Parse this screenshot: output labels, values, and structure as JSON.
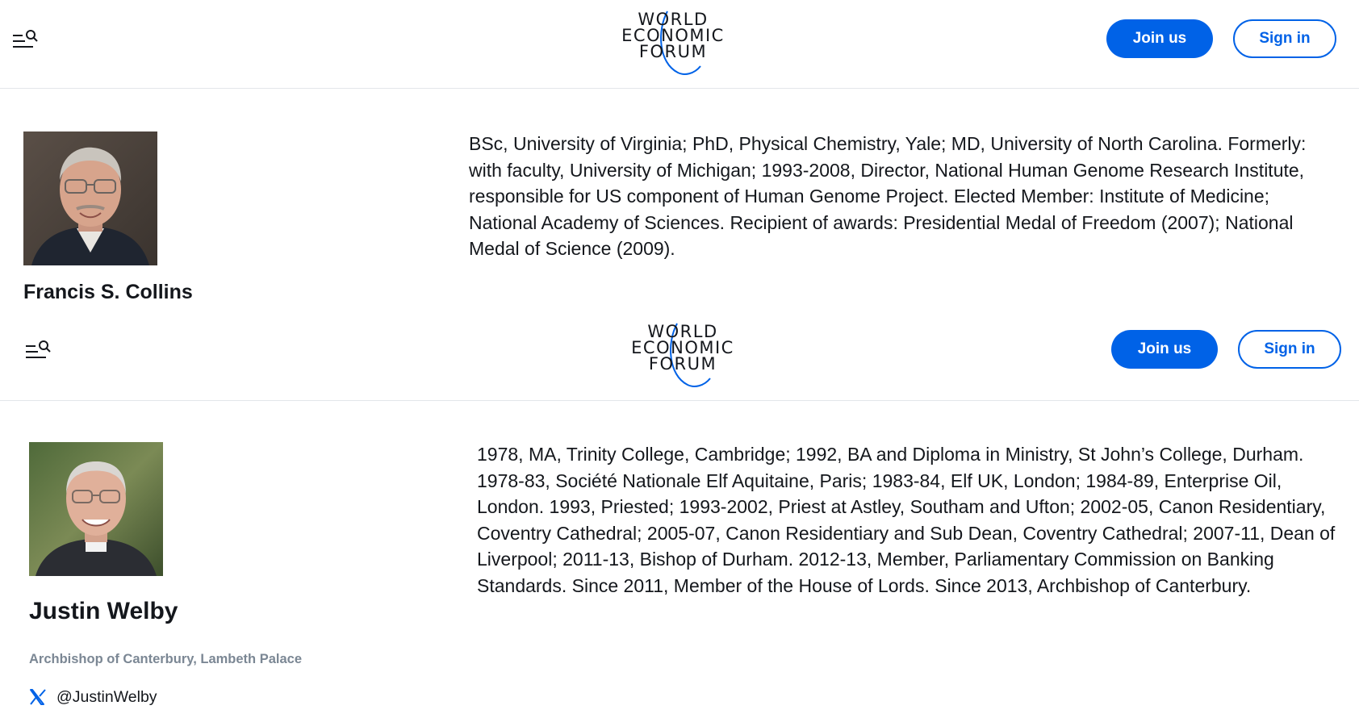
{
  "brand": {
    "logo_lines": [
      "WORLD",
      "ECONOMIC",
      "FORUM"
    ],
    "accent": "#0062e7"
  },
  "header": {
    "join_label": "Join us",
    "signin_label": "Sign in",
    "menu_icon": "menu-search-icon"
  },
  "profiles": [
    {
      "name": "Francis S. Collins",
      "bio": "BSc, University of Virginia; PhD, Physical Chemistry, Yale; MD, University of North Carolina. Formerly: with faculty, University of Michigan; 1993-2008, Director, National Human Genome Research Institute, responsible for US component of Human Genome Project. Elected Member: Institute of Medicine; National Academy of Sciences. Recipient of awards: Presidential Medal of Freedom (2007); National Medal of Science (2009)."
    },
    {
      "name": "Justin Welby",
      "title": "Archbishop of Canterbury, Lambeth Palace",
      "social_icon": "x-logo-icon",
      "handle": "@JustinWelby",
      "bio": "1978, MA, Trinity College, Cambridge; 1992, BA and Diploma in Ministry, St John’s College, Durham. 1978-83, Société Nationale Elf Aquitaine, Paris; 1983-84, Elf UK, London; 1984-89, Enterprise Oil, London. 1993, Priested; 1993-2002, Priest at Astley, Southam and Ufton; 2002-05, Canon Residentiary, Coventry Cathedral; 2005-07, Canon Residentiary and Sub Dean, Coventry Cathedral; 2007-11, Dean of Liverpool; 2011-13, Bishop of Durham. 2012-13, Member, Parliamentary Commission on Banking Standards. Since 2011, Member of the House of Lords. Since 2013, Archbishop of Canterbury."
    }
  ]
}
